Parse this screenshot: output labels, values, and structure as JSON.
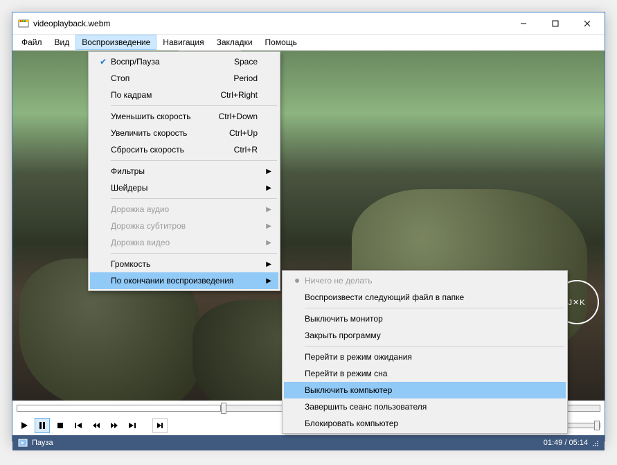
{
  "window": {
    "title": "videoplayback.webm"
  },
  "menubar": {
    "items": [
      {
        "label": "Файл"
      },
      {
        "label": "Вид"
      },
      {
        "label": "Воспроизведение",
        "active": true
      },
      {
        "label": "Навигация"
      },
      {
        "label": "Закладки"
      },
      {
        "label": "Помощь"
      }
    ]
  },
  "menu_playback": {
    "items": [
      {
        "label": "Воспр/Пауза",
        "shortcut": "Space",
        "checked": true
      },
      {
        "label": "Стоп",
        "shortcut": "Period"
      },
      {
        "label": "По кадрам",
        "shortcut": "Ctrl+Right"
      },
      {
        "sep": true
      },
      {
        "label": "Уменьшить скорость",
        "shortcut": "Ctrl+Down"
      },
      {
        "label": "Увеличить скорость",
        "shortcut": "Ctrl+Up"
      },
      {
        "label": "Сбросить скорость",
        "shortcut": "Ctrl+R"
      },
      {
        "sep": true
      },
      {
        "label": "Фильтры",
        "submenu": true
      },
      {
        "label": "Шейдеры",
        "submenu": true
      },
      {
        "sep": true
      },
      {
        "label": "Дорожка аудио",
        "submenu": true,
        "disabled": true
      },
      {
        "label": "Дорожка субтитров",
        "submenu": true,
        "disabled": true
      },
      {
        "label": "Дорожка видео",
        "submenu": true,
        "disabled": true
      },
      {
        "sep": true
      },
      {
        "label": "Громкость",
        "submenu": true
      },
      {
        "label": "По окончании воспроизведения",
        "submenu": true,
        "highlight": true
      }
    ]
  },
  "menu_after": {
    "items": [
      {
        "label": "Ничего не делать",
        "radio": true,
        "disabled": true
      },
      {
        "label": "Воспроизвести следующий файл в папке"
      },
      {
        "sep": true
      },
      {
        "label": "Выключить монитор"
      },
      {
        "label": "Закрыть программу"
      },
      {
        "sep": true
      },
      {
        "label": "Перейти в режим ожидания"
      },
      {
        "label": "Перейти в режим сна"
      },
      {
        "label": "Выключить компьютер",
        "highlight": true
      },
      {
        "label": "Завершить сеанс пользователя"
      },
      {
        "label": "Блокировать компьютер"
      }
    ]
  },
  "status": {
    "state": "Пауза",
    "time": "01:49 / 05:14"
  },
  "logo": "J✕K"
}
